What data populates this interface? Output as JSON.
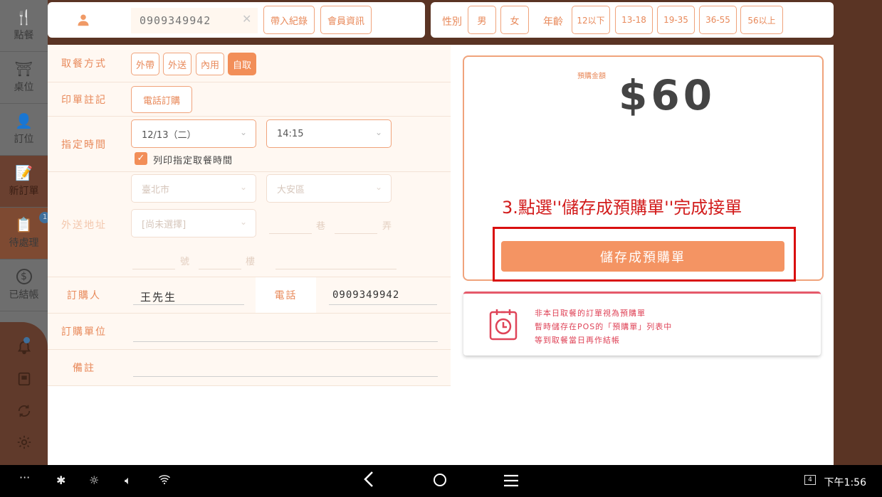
{
  "sidebar": {
    "items": [
      {
        "label": "點餐",
        "icon": "fork-knife-icon",
        "glyph": "🍴"
      },
      {
        "label": "桌位",
        "icon": "table-icon",
        "glyph": "⛩"
      },
      {
        "label": "訂位",
        "icon": "person-icon",
        "glyph": "👤"
      },
      {
        "label": "新訂單",
        "icon": "new-order-icon",
        "glyph": "📝"
      },
      {
        "label": "待處理",
        "icon": "clipboard-icon",
        "glyph": "📋"
      },
      {
        "label": "已結帳",
        "icon": "dollar-icon",
        "glyph": "$"
      }
    ],
    "pending_badge": "1"
  },
  "member": {
    "phone_placeholder": "0909349942",
    "history_button": "帶入紀錄",
    "info_button": "會員資訊"
  },
  "customer": {
    "gender_label": "性別",
    "male": "男",
    "female": "女",
    "age_label": "年齡",
    "ages": [
      "12以下",
      "13-18",
      "19-35",
      "36-55",
      "56以上"
    ]
  },
  "form": {
    "pickup_label": "取餐方式",
    "pickup_options": [
      "外帶",
      "外送",
      "內用",
      "自取"
    ],
    "pickup_selected": "自取",
    "print_note_label": "印單註記",
    "print_note_value": "電話訂購",
    "time_label": "指定時間",
    "date_value": "12/13（二）",
    "time_value": "14:15",
    "print_time_checkbox": "列印指定取餐時間",
    "address_label": "外送地址",
    "city": "臺北市",
    "district": "大安區",
    "road": "[尚未選擇]",
    "lane": "巷",
    "alley": "弄",
    "number": "號",
    "floor": "樓",
    "buyer_label": "訂購人",
    "buyer_value": "王先生",
    "phone_label": "電話",
    "phone_value": "0909349942",
    "unit_label": "訂購單位",
    "note_label": "備註"
  },
  "prepay": {
    "label": "預購金額",
    "amount": "$60",
    "instruction": "3.點選''儲存成預購單''完成接單",
    "save_button": "儲存成預購單"
  },
  "info": {
    "line1": "非本日取餐的訂單視為預購單",
    "line2": "暫時儲存在POS的「預購單」列表中",
    "line3": "等到取餐當日再作結帳"
  },
  "system": {
    "clock": "下午1:56",
    "notification_count": "4"
  },
  "colors": {
    "accent": "#f28e58",
    "brown": "#5a3424",
    "warning_red": "#d21c1c"
  }
}
